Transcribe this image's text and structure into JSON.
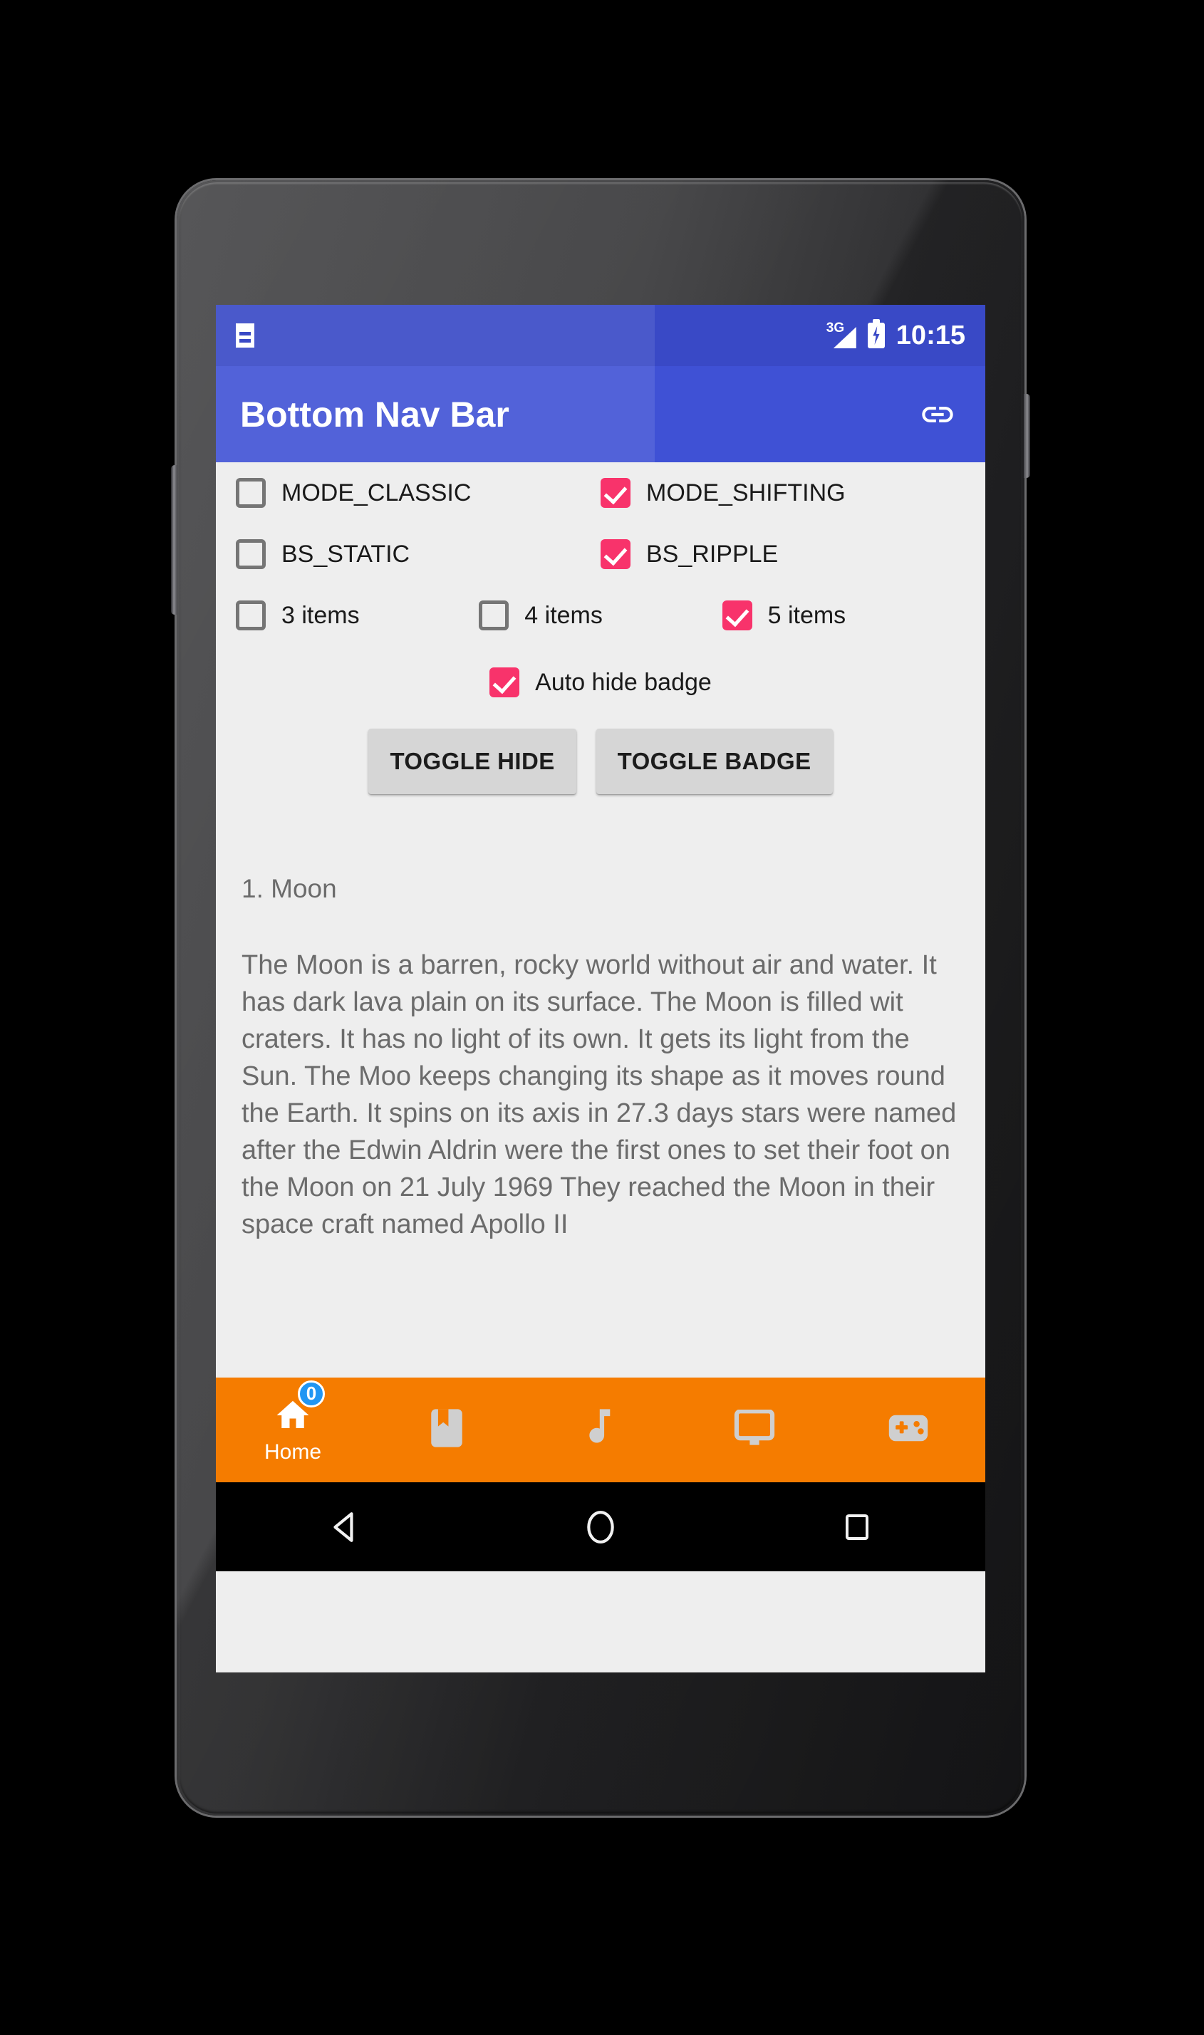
{
  "device": {
    "frame_name": "nexus-5",
    "bezel_color": "#3a3a3c"
  },
  "status_bar": {
    "notification_icon": "document-icon",
    "network_label": "3G",
    "signal_icon": "signal-triangle-icon",
    "battery_icon": "battery-charging-icon",
    "clock": "10:15",
    "background_color": "#3949c6"
  },
  "app_bar": {
    "title": "Bottom Nav Bar",
    "action_icon": "link-icon",
    "background_color": "#3f51d5",
    "title_color": "#ffffff"
  },
  "content": {
    "background_color": "#eeeeee",
    "accent_checked_color": "#f8336b",
    "checkbox_rows": [
      {
        "cells": [
          {
            "label": "MODE_CLASSIC",
            "checked": false
          },
          {
            "label": "MODE_SHIFTING",
            "checked": true
          }
        ]
      },
      {
        "cells": [
          {
            "label": "BS_STATIC",
            "checked": false
          },
          {
            "label": "BS_RIPPLE",
            "checked": true
          }
        ]
      },
      {
        "cells": [
          {
            "label": "3 items",
            "checked": false
          },
          {
            "label": "4 items",
            "checked": false
          },
          {
            "label": "5 items",
            "checked": true
          }
        ]
      }
    ],
    "auto_hide_badge": {
      "label": "Auto hide badge",
      "checked": true
    },
    "buttons": [
      {
        "label": "TOGGLE HIDE"
      },
      {
        "label": "TOGGLE BADGE"
      }
    ],
    "article": {
      "heading": "1. Moon",
      "body": "The Moon is a barren, rocky world without air and water. It has dark lava plain on its surface. The Moon is filled wit craters. It has no light of its own. It gets its light from the Sun. The Moo keeps changing its shape as it moves round the Earth. It spins on its axis in 27.3 days stars were named after the Edwin Aldrin were the first ones to set their foot on the Moon on 21 July 1969 They reached the Moon in their space craft named Apollo II"
    }
  },
  "bottom_nav": {
    "background_color": "#f57c00",
    "active_index": 0,
    "badge_color": "#2196f3",
    "items": [
      {
        "label": "Home",
        "icon": "home-icon",
        "active": true,
        "badge": "0"
      },
      {
        "label": "",
        "icon": "bookmark-icon",
        "active": false,
        "badge": null
      },
      {
        "label": "",
        "icon": "music-note-icon",
        "active": false,
        "badge": null
      },
      {
        "label": "",
        "icon": "tv-monitor-icon",
        "active": false,
        "badge": null
      },
      {
        "label": "",
        "icon": "gamepad-icon",
        "active": false,
        "badge": null
      }
    ]
  },
  "android_nav": {
    "buttons": [
      {
        "name": "back",
        "icon": "back-triangle-icon"
      },
      {
        "name": "home",
        "icon": "home-circle-icon"
      },
      {
        "name": "recents",
        "icon": "recents-square-icon"
      }
    ]
  }
}
